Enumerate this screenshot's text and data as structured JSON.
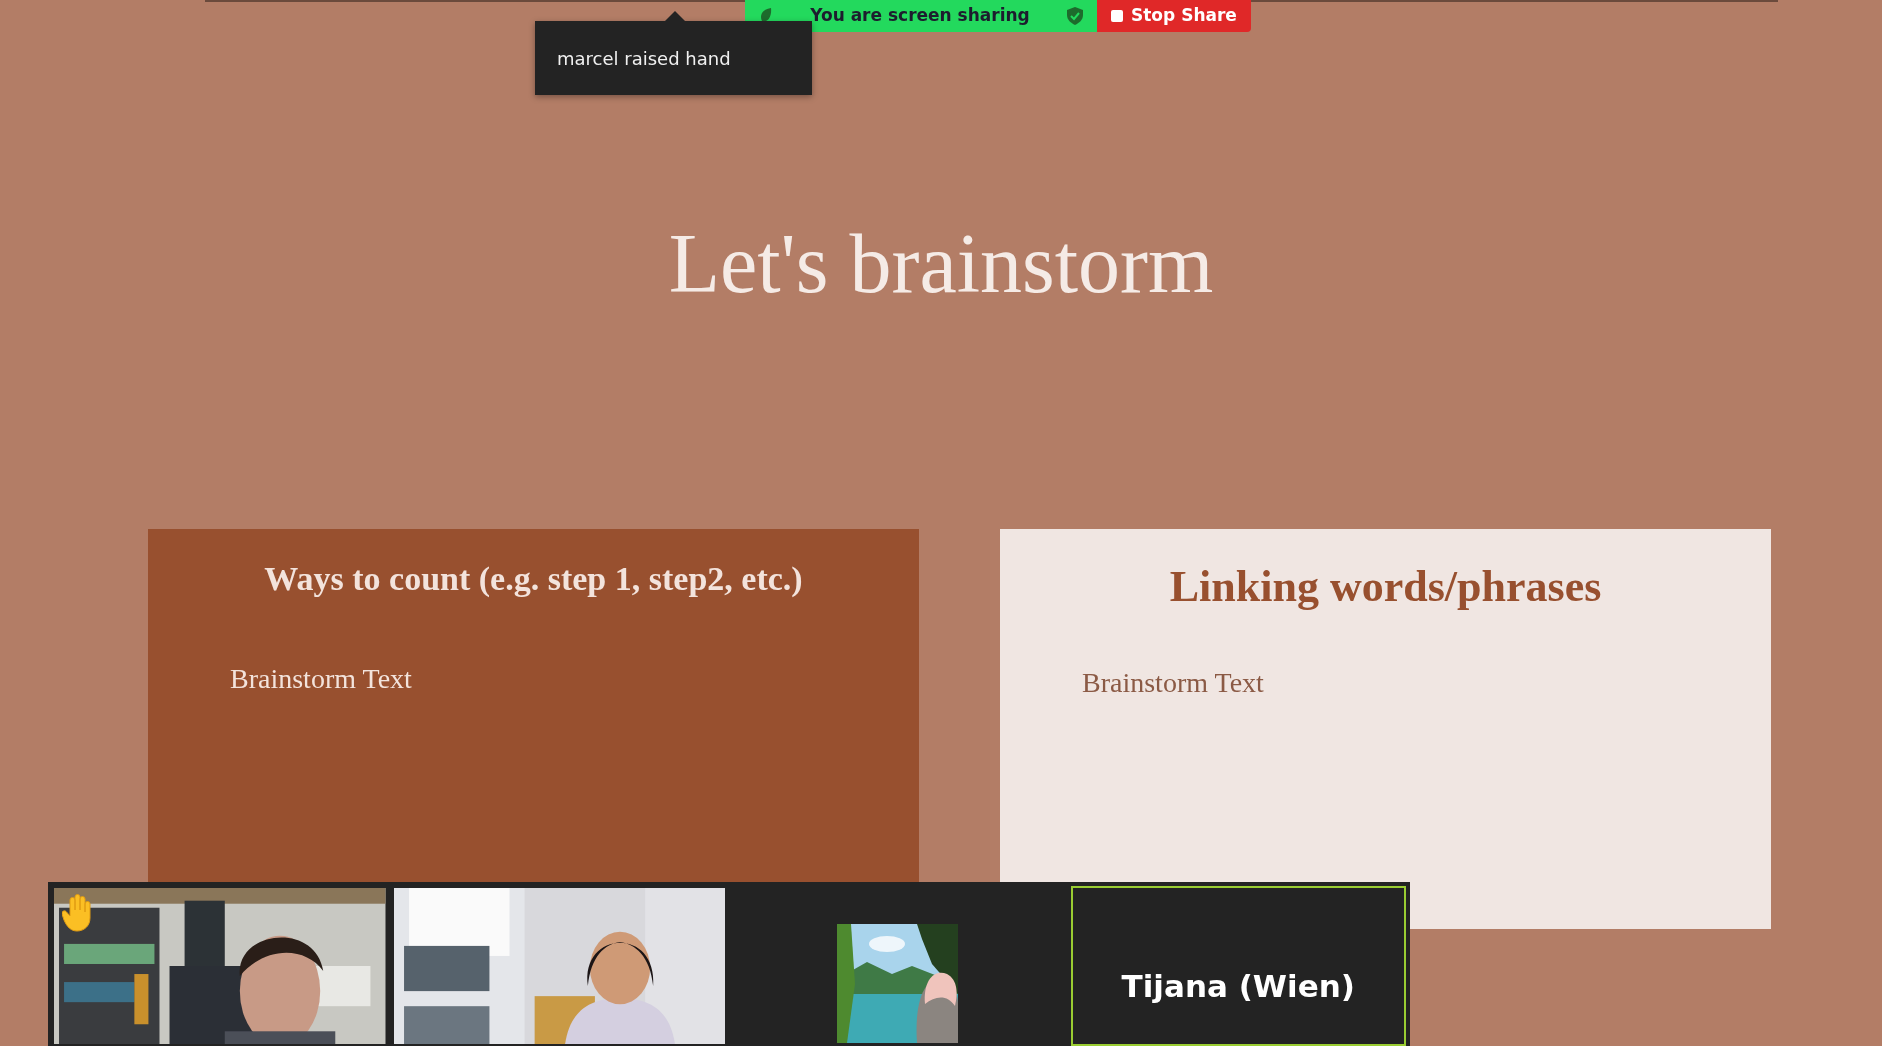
{
  "notification": {
    "text": "marcel raised hand"
  },
  "share_bar": {
    "status": "You are screen sharing",
    "stop_button": "Stop Share"
  },
  "slide": {
    "title": "Let's brainstorm",
    "boxes": [
      {
        "kind": "dark",
        "heading": "Ways to count (e.g. step 1, step2, etc.)",
        "body": "Brainstorm Text"
      },
      {
        "kind": "light",
        "heading": "Linking words/phrases",
        "body": "Brainstorm Text"
      }
    ]
  },
  "video_strip": {
    "tiles": [
      {
        "kind": "video",
        "hand_raised": true,
        "speaking": false
      },
      {
        "kind": "video",
        "hand_raised": false,
        "speaking": false
      },
      {
        "kind": "avatar",
        "hand_raised": false,
        "speaking": false
      },
      {
        "kind": "name",
        "name": "Tijana (Wien)",
        "hand_raised": false,
        "speaking": true
      }
    ]
  }
}
